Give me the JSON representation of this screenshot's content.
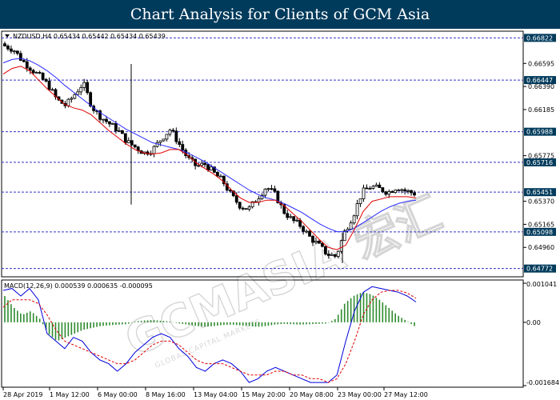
{
  "page": {
    "title": "Chart Analysis for Clients of GCM Asia"
  },
  "watermark": {
    "text": "GCMASIA 宏汇",
    "subtext": "GLOBAL CAPITAL MARKETS"
  },
  "chart_data": [
    {
      "type": "candlestick",
      "header": "NZDUSD,H4  0.65434 0.65442 0.65434 0.65439",
      "symbol": "NZDUSD",
      "timeframe": "H4",
      "last_ohlc": [
        0.65434,
        0.65442,
        0.65434,
        0.65439
      ],
      "ylim": [
        0.6472,
        0.6686
      ],
      "yticks": [
        0.66595,
        0.6639,
        0.66185,
        0.65775,
        0.6537,
        0.65165,
        0.6496
      ],
      "xtick_labels": [
        "28 Apr 2019",
        "1 May 12:00",
        "6 May 00:00",
        "8 May 16:00",
        "13 May 04:00",
        "15 May 20:00",
        "20 May 08:00",
        "23 May 00:00",
        "27 May 12:00"
      ],
      "levels": [
        {
          "value": 0.66822,
          "label": "0.66822"
        },
        {
          "value": 0.66447,
          "label": "0.66447"
        },
        {
          "value": 0.65988,
          "label": "0.65988"
        },
        {
          "value": 0.65716,
          "label": "0.65716"
        },
        {
          "value": 0.65451,
          "label": "0.65451"
        },
        {
          "value": 0.65098,
          "label": "0.65098"
        },
        {
          "value": 0.64772,
          "label": "0.64772"
        }
      ],
      "colors": {
        "bull": "#ffffff",
        "bear": "#000000",
        "ma_fast": "#e00000",
        "ma_slow": "#2a2aff",
        "level": "#3333cc"
      },
      "close_path": [
        0.6675,
        0.6672,
        0.6662,
        0.6655,
        0.6648,
        0.664,
        0.6627,
        0.6622,
        0.6632,
        0.6642,
        0.6621,
        0.6612,
        0.6606,
        0.66,
        0.659,
        0.6585,
        0.658,
        0.6583,
        0.6593,
        0.6601,
        0.6588,
        0.6575,
        0.6568,
        0.657,
        0.6562,
        0.6555,
        0.6542,
        0.6533,
        0.653,
        0.654,
        0.655,
        0.6543,
        0.6528,
        0.652,
        0.6515,
        0.6505,
        0.6498,
        0.649,
        0.6488,
        0.651,
        0.6525,
        0.6545,
        0.655,
        0.6548,
        0.6545,
        0.655,
        0.6546,
        0.6544
      ],
      "ma_fast_path": [
        0.665,
        0.6655,
        0.6657,
        0.6653,
        0.6645,
        0.6637,
        0.663,
        0.6623,
        0.662,
        0.6618,
        0.6614,
        0.6607,
        0.66,
        0.6594,
        0.6588,
        0.6583,
        0.658,
        0.6579,
        0.658,
        0.6583,
        0.6583,
        0.6578,
        0.6571,
        0.6566,
        0.6561,
        0.6555,
        0.6547,
        0.654,
        0.6536,
        0.6536,
        0.6538,
        0.6538,
        0.6533,
        0.6526,
        0.6519,
        0.6511,
        0.6503,
        0.6496,
        0.6494,
        0.6498,
        0.6512,
        0.6528,
        0.6537,
        0.6539,
        0.6541,
        0.6541,
        0.6541,
        0.654
      ],
      "ma_slow_path": [
        0.666,
        0.6663,
        0.6664,
        0.6662,
        0.6658,
        0.6653,
        0.6647,
        0.664,
        0.6634,
        0.6628,
        0.6622,
        0.6616,
        0.6611,
        0.6606,
        0.6601,
        0.6597,
        0.6593,
        0.6589,
        0.6587,
        0.6585,
        0.6583,
        0.658,
        0.6576,
        0.6572,
        0.6567,
        0.6562,
        0.6557,
        0.6552,
        0.6547,
        0.6543,
        0.654,
        0.6538,
        0.6535,
        0.6531,
        0.6527,
        0.6522,
        0.6517,
        0.6513,
        0.651,
        0.651,
        0.6513,
        0.6518,
        0.6523,
        0.6528,
        0.6532,
        0.6535,
        0.6537,
        0.6538
      ]
    },
    {
      "type": "line",
      "header": "MACD(12,26,9)  0.000539 0.000635 -0.000095",
      "ylim": [
        -0.001684,
        0.001041
      ],
      "yticks": [
        0.001041,
        0.0,
        -0.001684
      ],
      "ytick_labels": [
        "0.001041",
        "0.00",
        "-0.001684"
      ],
      "colors": {
        "macd": "#0000dd",
        "signal": "#dd0000",
        "hist": "#2e8b2e"
      },
      "macd": [
        0.00085,
        0.0009,
        0.0007,
        0.0009,
        0.0006,
        -0.0003,
        -0.0005,
        -0.0007,
        -0.0004,
        -0.0005,
        -0.0008,
        -0.001,
        -0.0011,
        -0.0013,
        -0.0011,
        -0.0008,
        -0.0006,
        -0.0004,
        -0.0003,
        -0.0004,
        -0.0007,
        -0.0009,
        -0.0012,
        -0.0013,
        -0.0011,
        -0.001,
        -0.0011,
        -0.0013,
        -0.0016,
        -0.0015,
        -0.0013,
        -0.0012,
        -0.0013,
        -0.0014,
        -0.0015,
        -0.0016,
        -0.0016,
        -0.0016,
        -0.0014,
        -0.0005,
        0.0003,
        0.0008,
        0.00095,
        0.0009,
        0.00085,
        0.0008,
        0.0007,
        0.00054
      ],
      "signal": [
        0.0004,
        0.0006,
        0.0006,
        0.0006,
        0.0005,
        0.0002,
        -0.0002,
        -0.0005,
        -0.0006,
        -0.0007,
        -0.0008,
        -0.0009,
        -0.001,
        -0.0011,
        -0.0011,
        -0.001,
        -0.0008,
        -0.0006,
        -0.0005,
        -0.0005,
        -0.0006,
        -0.0008,
        -0.001,
        -0.0011,
        -0.0011,
        -0.0011,
        -0.0012,
        -0.0013,
        -0.0014,
        -0.0014,
        -0.0014,
        -0.0013,
        -0.0013,
        -0.0014,
        -0.0014,
        -0.0015,
        -0.0015,
        -0.0016,
        -0.0015,
        -0.0011,
        -0.0005,
        0.0002,
        0.0006,
        0.0008,
        0.00085,
        0.00085,
        0.00078,
        0.00064
      ],
      "hist": [
        0.0007,
        0.0004,
        0.0002,
        0.0003,
        0.0001,
        -0.0003,
        -0.0005,
        -0.0004,
        -0.0003,
        -0.0002,
        -0.00015,
        -0.0001,
        -8e-05,
        -6e-05,
        -5e-05,
        2e-05,
        5e-05,
        6e-05,
        4e-05,
        2e-05,
        -3e-05,
        -6e-05,
        -0.0001,
        -0.00012,
        -0.0001,
        -7e-05,
        -6e-05,
        -8e-05,
        -0.0001,
        -0.00012,
        -0.0001,
        -6e-05,
        -4e-05,
        -5e-05,
        -6e-05,
        -5e-05,
        -4e-05,
        -3e-05,
        0.0001,
        0.0005,
        0.0007,
        0.0008,
        0.00075,
        0.0006,
        0.0004,
        0.0002,
        5e-05,
        -0.0001
      ]
    }
  ]
}
